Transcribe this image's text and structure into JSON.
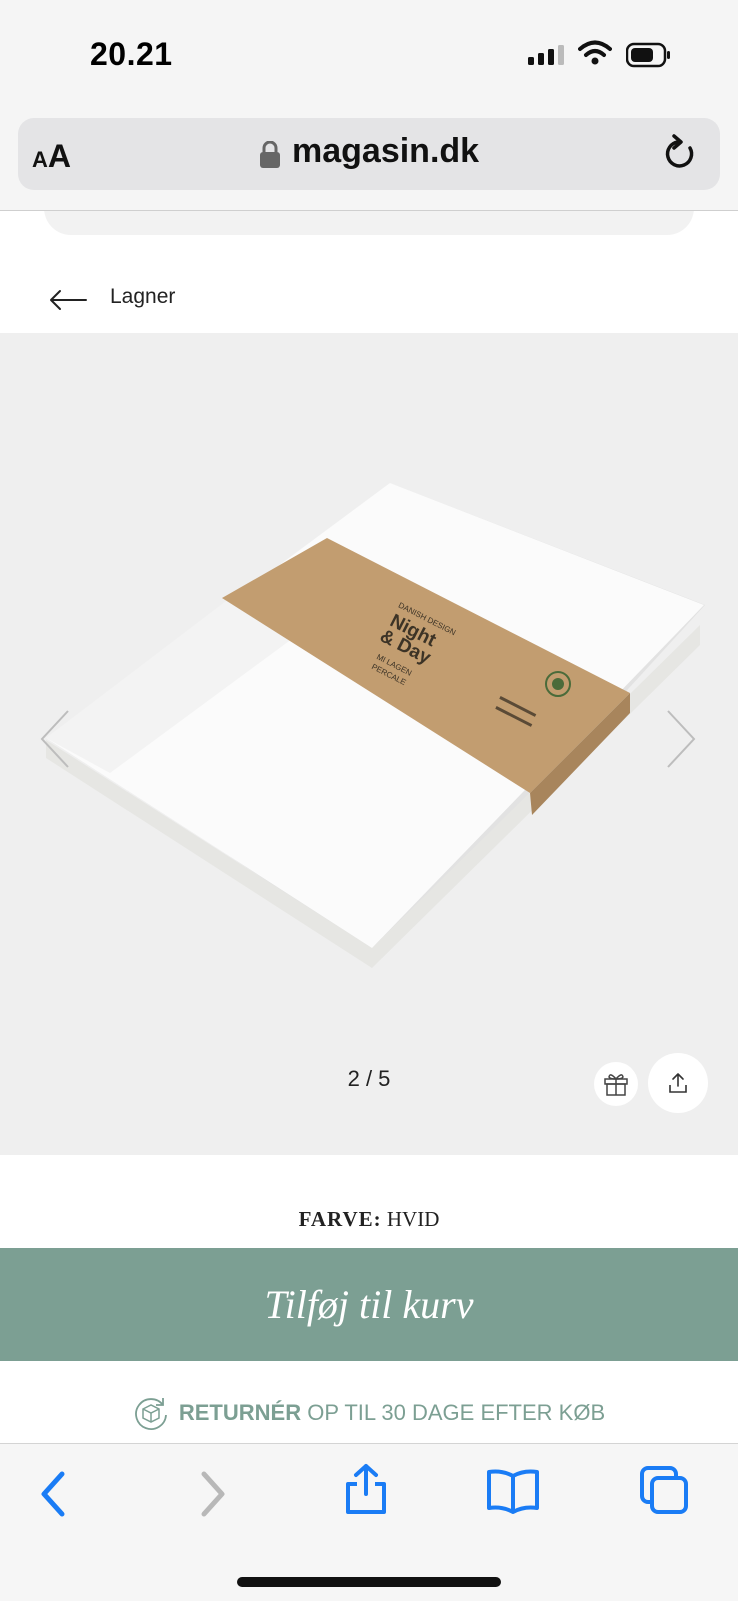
{
  "status_bar": {
    "time": "20.21",
    "battery_icon": "battery-icon",
    "wifi_icon": "wifi-icon",
    "signal_icon": "signal-icon"
  },
  "url_bar": {
    "text_size_small": "A",
    "text_size_large": "A",
    "domain": "magasin.dk",
    "lock_icon": "lock-icon",
    "reload_icon": "reload-icon"
  },
  "breadcrumb": {
    "label": "Lagner"
  },
  "gallery": {
    "counter": "2 / 5",
    "product_band": {
      "brand_top": "DANISH DESIGN",
      "brand_line1": "Night",
      "brand_line2": "& Day",
      "product_line1": "MI LAGEN",
      "product_line2": "PERCALE"
    }
  },
  "variant": {
    "label": "FARVE:",
    "value": "HVID"
  },
  "cta": {
    "add_to_cart": "Tilføj til kurv"
  },
  "returns": {
    "strong": "RETURNÉR",
    "rest": "OP TIL 30 DAGE EFTER KØB"
  },
  "colors": {
    "accent": "#7c9f93",
    "safari_blue": "#1a7cf5"
  }
}
